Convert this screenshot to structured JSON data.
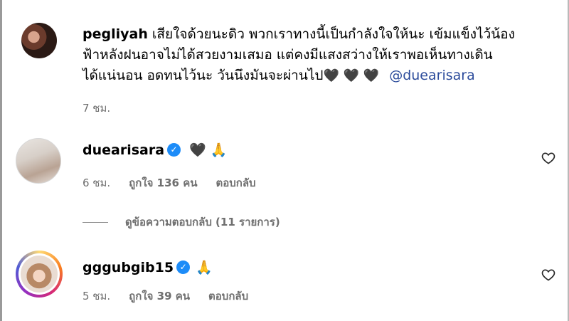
{
  "comments": [
    {
      "username": "pegliyah",
      "text_line1": "เสียใจด้วยนะดิว พวกเราทางนี้เป็นกำลังใจให้นะ เข้มแข็งไว้น้อง",
      "text_line2": "ฟ้าหลังฝนอาจไม่ได้สวยงามเสมอ แต่คงมีแสงสว่างให้เราพอเห็นทางเดิน",
      "text_line3": "ได้แน่นอน อดทนไว้นะ วันนึงมันจะผ่านไป",
      "hearts": "🖤 🖤 🖤",
      "mention": "@duearisara",
      "time": "7 ชม."
    },
    {
      "username": "duearisara",
      "verified": true,
      "text": "🖤 🙏",
      "time": "6 ชม.",
      "likes": "ถูกใจ 136 คน",
      "reply_label": "ตอบกลับ"
    },
    {
      "username": "gggubgib15",
      "verified": true,
      "text": "🙏",
      "time": "5 ชม.",
      "likes": "ถูกใจ 39 คน",
      "reply_label": "ตอบกลับ"
    }
  ],
  "view_replies": "ดูข้อความตอบกลับ (11 รายการ)",
  "icons": {
    "like": "heart-outline-icon",
    "verified": "verified-badge-icon"
  },
  "colors": {
    "mention": "#2b4b9b",
    "verified": "#1d8cf8",
    "meta": "#6f6f6f"
  }
}
